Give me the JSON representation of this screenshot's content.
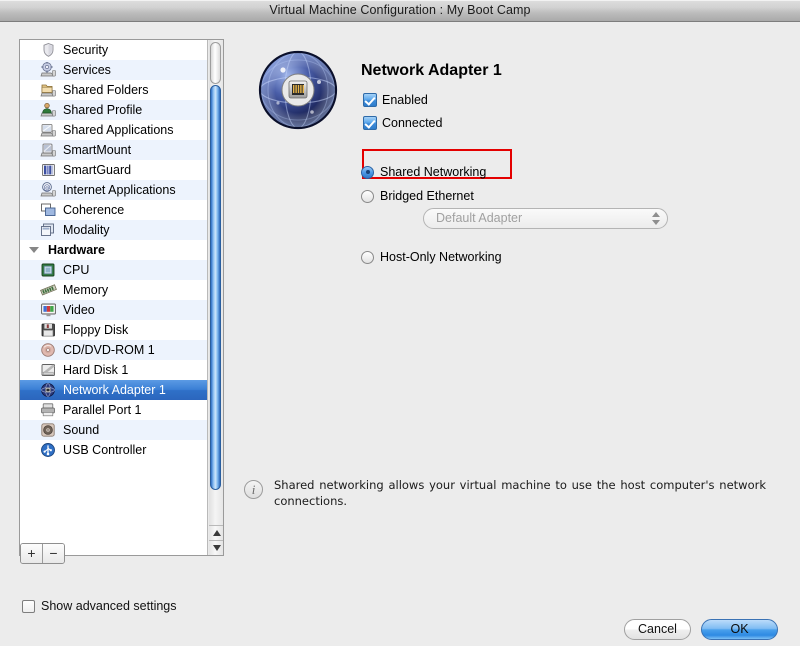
{
  "window": {
    "title": "Virtual Machine Configuration : My Boot Camp"
  },
  "sidebar": {
    "items": [
      {
        "label": "Security",
        "icon": "shield-icon",
        "group": false
      },
      {
        "label": "Services",
        "icon": "services-gear-icon",
        "group": false
      },
      {
        "label": "Shared Folders",
        "icon": "shared-folders-icon",
        "group": false
      },
      {
        "label": "Shared Profile",
        "icon": "shared-profile-icon",
        "group": false
      },
      {
        "label": "Shared Applications",
        "icon": "shared-applications-icon",
        "group": false
      },
      {
        "label": "SmartMount",
        "icon": "smartmount-icon",
        "group": false
      },
      {
        "label": "SmartGuard",
        "icon": "smartguard-icon",
        "group": false
      },
      {
        "label": "Internet Applications",
        "icon": "internet-applications-icon",
        "group": false
      },
      {
        "label": "Coherence",
        "icon": "coherence-icon",
        "group": false
      },
      {
        "label": "Modality",
        "icon": "modality-icon",
        "group": false
      },
      {
        "label": "Hardware",
        "icon": "disclosure-triangle-icon",
        "group": true
      },
      {
        "label": "CPU",
        "icon": "cpu-icon",
        "group": false
      },
      {
        "label": "Memory",
        "icon": "memory-icon",
        "group": false
      },
      {
        "label": "Video",
        "icon": "video-icon",
        "group": false
      },
      {
        "label": "Floppy Disk",
        "icon": "floppy-disk-icon",
        "group": false
      },
      {
        "label": "CD/DVD-ROM 1",
        "icon": "cd-dvd-rom-icon",
        "group": false
      },
      {
        "label": "Hard Disk 1",
        "icon": "hard-disk-icon",
        "group": false
      },
      {
        "label": "Network Adapter 1",
        "icon": "network-adapter-icon",
        "group": false,
        "selected": true
      },
      {
        "label": "Parallel Port 1",
        "icon": "parallel-port-icon",
        "group": false
      },
      {
        "label": "Sound",
        "icon": "sound-icon",
        "group": false
      },
      {
        "label": "USB Controller",
        "icon": "usb-controller-icon",
        "group": false
      }
    ],
    "add_button_label": "+",
    "remove_button_label": "−"
  },
  "advanced": {
    "label": "Show advanced settings",
    "checked": false
  },
  "panel": {
    "icon": "network-adapter-large-icon",
    "title": "Network Adapter 1",
    "checkboxes": [
      {
        "label": "Enabled",
        "checked": true
      },
      {
        "label": "Connected",
        "checked": true
      }
    ],
    "radios": [
      {
        "label": "Shared Networking",
        "selected": true,
        "highlighted": true
      },
      {
        "label": "Bridged Ethernet",
        "selected": false,
        "highlighted": false
      },
      {
        "label": "Host-Only Networking",
        "selected": false,
        "highlighted": false
      }
    ],
    "adapter_popup": {
      "value": "Default Adapter",
      "enabled": false
    },
    "info": {
      "icon": "info-icon",
      "text": "Shared networking allows your virtual machine to use the host computer's network connections."
    }
  },
  "buttons": {
    "cancel": "Cancel",
    "ok": "OK"
  },
  "colors": {
    "selection_blue": "#2f70c8",
    "annotation_red": "#e40000",
    "default_button_blue": "#2e8ae3",
    "window_background": "#ececec",
    "list_stripe": "#edf3fd"
  }
}
